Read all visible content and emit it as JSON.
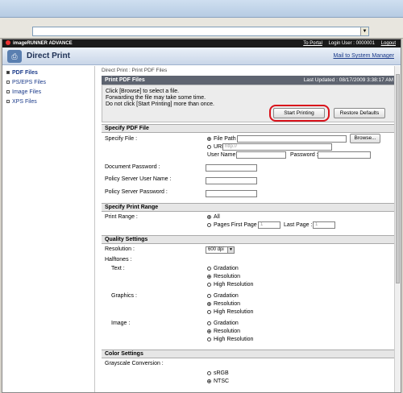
{
  "header": {
    "brand": "imageRUNNER ADVANCE",
    "to_portal": "To Portal",
    "login_user": "Login User : 0000001",
    "logout": "Logout",
    "title": "Direct Print",
    "system_manager": "Mail to System Manager"
  },
  "sidebar": {
    "items": [
      {
        "label": "PDF Files"
      },
      {
        "label": "PS/EPS Files"
      },
      {
        "label": "Image Files"
      },
      {
        "label": "XPS Files"
      }
    ]
  },
  "main": {
    "breadcrumb": "Direct Print : Print PDF Files",
    "section_title": "Print PDF Files",
    "last_updated": "Last Updated : 08/17/2009 3:38:17 AM",
    "instructions": [
      "Click [Browse] to select a file.",
      "Forwarding the file may take some time.",
      "Do not click [Start Printing] more than once."
    ],
    "start_printing": "Start Printing",
    "restore_defaults": "Restore Defaults",
    "specify_pdf": {
      "heading": "Specify PDF File",
      "specify_file_label": "Specify File :",
      "file_path": "File Path",
      "browse": "Browse...",
      "url": "URL",
      "url_placeholder": "http://",
      "user_name": "User Name :",
      "password": "Password :",
      "document_password": "Document Password :",
      "policy_user": "Policy Server User Name :",
      "policy_password": "Policy Server Password :"
    },
    "print_range": {
      "heading": "Specify Print Range",
      "label": "Print Range :",
      "all": "All",
      "pages_first": "Pages First Page :",
      "first_value": "1",
      "last_page": "Last Page :",
      "last_value": "1"
    },
    "quality": {
      "heading": "Quality Settings",
      "resolution_label": "Resolution :",
      "resolution_value": "600 dpi",
      "halftones": "Halftones :",
      "text": "Text :",
      "graphics": "Graphics :",
      "image": "Image :",
      "gradation": "Gradation",
      "resolution": "Resolution",
      "high_resolution": "High Resolution"
    },
    "color": {
      "heading": "Color Settings",
      "grayscale_label": "Grayscale Conversion :",
      "srgb": "sRGB",
      "ntsc": "NTSC"
    }
  }
}
